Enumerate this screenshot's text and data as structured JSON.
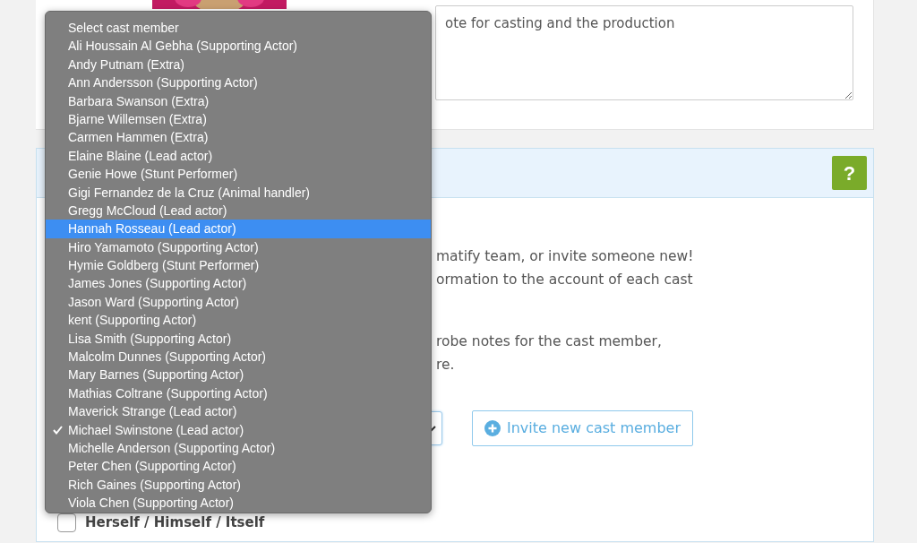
{
  "profile": {
    "notes": {
      "placeholder": "ote for casting and the production"
    }
  },
  "cast_panel": {
    "help_button": "?",
    "paragraphs": [
      "matify team, or invite someone new!\normation to the account of each cast",
      "robe notes for the cast member,\nre."
    ],
    "invite_button": "Invite new cast member",
    "self_checkbox": {
      "label": "Herself / Himself / Itself",
      "checked": false
    }
  },
  "dropdown": {
    "items": [
      {
        "label": "Select cast member",
        "selected": false,
        "checked": false
      },
      {
        "label": "Ali Houssain Al Gebha (Supporting Actor)",
        "selected": false,
        "checked": false
      },
      {
        "label": "Andy Putnam (Extra)",
        "selected": false,
        "checked": false
      },
      {
        "label": "Ann Andersson (Supporting Actor)",
        "selected": false,
        "checked": false
      },
      {
        "label": "Barbara Swanson (Extra)",
        "selected": false,
        "checked": false
      },
      {
        "label": "Bjarne Willemsen (Extra)",
        "selected": false,
        "checked": false
      },
      {
        "label": "Carmen Hammen (Extra)",
        "selected": false,
        "checked": false
      },
      {
        "label": "Elaine Blaine (Lead actor)",
        "selected": false,
        "checked": false
      },
      {
        "label": "Genie Howe (Stunt Performer)",
        "selected": false,
        "checked": false
      },
      {
        "label": "Gigi Fernandez de la Cruz (Animal handler)",
        "selected": false,
        "checked": false
      },
      {
        "label": "Gregg McCloud (Lead actor)",
        "selected": false,
        "checked": false
      },
      {
        "label": "Hannah Rosseau (Lead actor)",
        "selected": true,
        "checked": false
      },
      {
        "label": "Hiro Yamamoto (Supporting Actor)",
        "selected": false,
        "checked": false
      },
      {
        "label": "Hymie Goldberg (Stunt Performer)",
        "selected": false,
        "checked": false
      },
      {
        "label": "James Jones (Supporting Actor)",
        "selected": false,
        "checked": false
      },
      {
        "label": "Jason Ward (Supporting Actor)",
        "selected": false,
        "checked": false
      },
      {
        "label": "kent (Supporting Actor)",
        "selected": false,
        "checked": false
      },
      {
        "label": "Lisa Smith (Supporting Actor)",
        "selected": false,
        "checked": false
      },
      {
        "label": "Malcolm Dunnes (Supporting Actor)",
        "selected": false,
        "checked": false
      },
      {
        "label": "Mary Barnes (Supporting Actor)",
        "selected": false,
        "checked": false
      },
      {
        "label": "Mathias Coltrane (Supporting Actor)",
        "selected": false,
        "checked": false
      },
      {
        "label": "Maverick Strange (Lead actor)",
        "selected": false,
        "checked": false
      },
      {
        "label": "Michael Swinstone (Lead actor)",
        "selected": false,
        "checked": true
      },
      {
        "label": "Michelle Anderson (Supporting Actor)",
        "selected": false,
        "checked": false
      },
      {
        "label": "Peter Chen (Supporting Actor)",
        "selected": false,
        "checked": false
      },
      {
        "label": "Rich Gaines (Supporting Actor)",
        "selected": false,
        "checked": false
      },
      {
        "label": "Viola Chen (Supporting Actor)",
        "selected": false,
        "checked": false
      }
    ]
  }
}
